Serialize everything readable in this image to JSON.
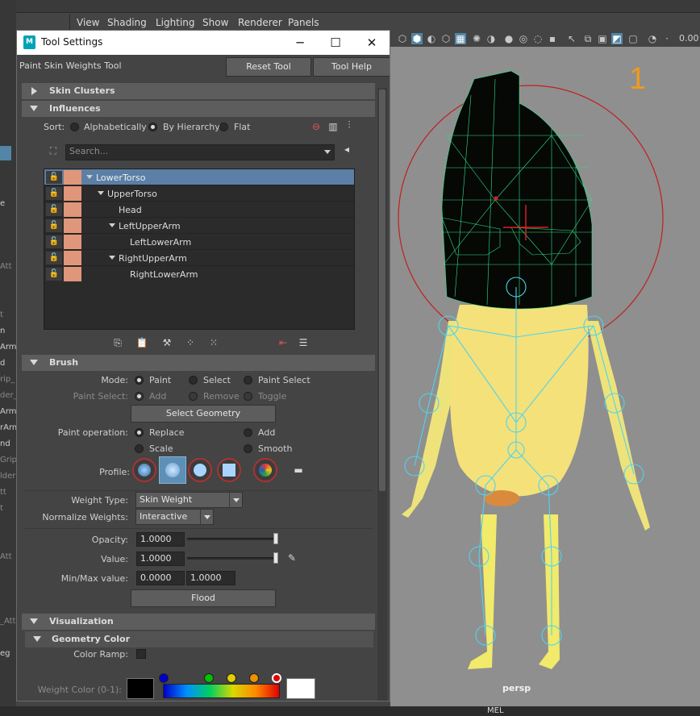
{
  "main_window": {
    "left_fragments": [
      "e",
      "Att",
      "t",
      "n",
      "Arm",
      "d",
      "rip_",
      "der_",
      "Arm",
      "rArm",
      "nd",
      "Grip",
      "lder",
      "tt",
      "",
      "t",
      "Att",
      "",
      "_Att",
      "",
      "eg"
    ],
    "viewport_menu": [
      "View",
      "Shading",
      "Lighting",
      "Show",
      "Renderer",
      "Panels"
    ],
    "viewport_zoom": "0.00",
    "camera_label": "persp",
    "annotation": "1",
    "command_line_label": "MEL"
  },
  "tool_window": {
    "title": "Tool Settings",
    "app_icon": "M",
    "tool_name": "Paint Skin Weights Tool",
    "reset_label": "Reset Tool",
    "help_label": "Tool Help",
    "window_buttons": {
      "minimize": "─",
      "maximize": "☐",
      "close": "✕"
    }
  },
  "sections": {
    "skin_clusters": "Skin Clusters",
    "influences": "Influences",
    "brush": "Brush",
    "visualization": "Visualization",
    "geometry_color": "Geometry Color"
  },
  "influences": {
    "sort_label": "Sort:",
    "sort_options": [
      "Alphabetically",
      "By Hierarchy",
      "Flat"
    ],
    "sort_selected": "By Hierarchy",
    "search_placeholder": "Search...",
    "items": [
      {
        "name": "LowerTorso",
        "selected": true
      },
      {
        "name": "UpperTorso"
      },
      {
        "name": "Head"
      },
      {
        "name": "LeftUpperArm"
      },
      {
        "name": "LeftLowerArm"
      },
      {
        "name": "RightUpperArm"
      },
      {
        "name": "RightLowerArm"
      }
    ],
    "swatch_color": "#e0967a"
  },
  "brush": {
    "mode_label": "Mode:",
    "mode_options": [
      "Paint",
      "Select",
      "Paint Select"
    ],
    "mode_selected": "Paint",
    "paint_select_label": "Paint Select:",
    "paint_select_options": [
      "Add",
      "Remove",
      "Toggle"
    ],
    "select_geometry_label": "Select Geometry",
    "paint_op_label": "Paint operation:",
    "paint_op_options": [
      "Replace",
      "Add",
      "Scale",
      "Smooth"
    ],
    "paint_op_selected": "Replace",
    "profile_label": "Profile:",
    "weight_type_label": "Weight Type:",
    "weight_type_value": "Skin Weight",
    "normalize_label": "Normalize Weights:",
    "normalize_value": "Interactive",
    "opacity_label": "Opacity:",
    "opacity_value": "1.0000",
    "opacity_level": 1.0,
    "value_label": "Value:",
    "value_value": "1.0000",
    "value_level": 1.0,
    "minmax_label": "Min/Max value:",
    "min_value": "0.0000",
    "max_value": "1.0000",
    "flood_label": "Flood"
  },
  "geometry_color": {
    "color_ramp_label": "Color Ramp:",
    "weight_color_label": "Weight Color (0-1):",
    "ramp_keys": [
      "#0000c8",
      "#00c000",
      "#e0d000",
      "#f09000",
      "#e00000"
    ]
  }
}
